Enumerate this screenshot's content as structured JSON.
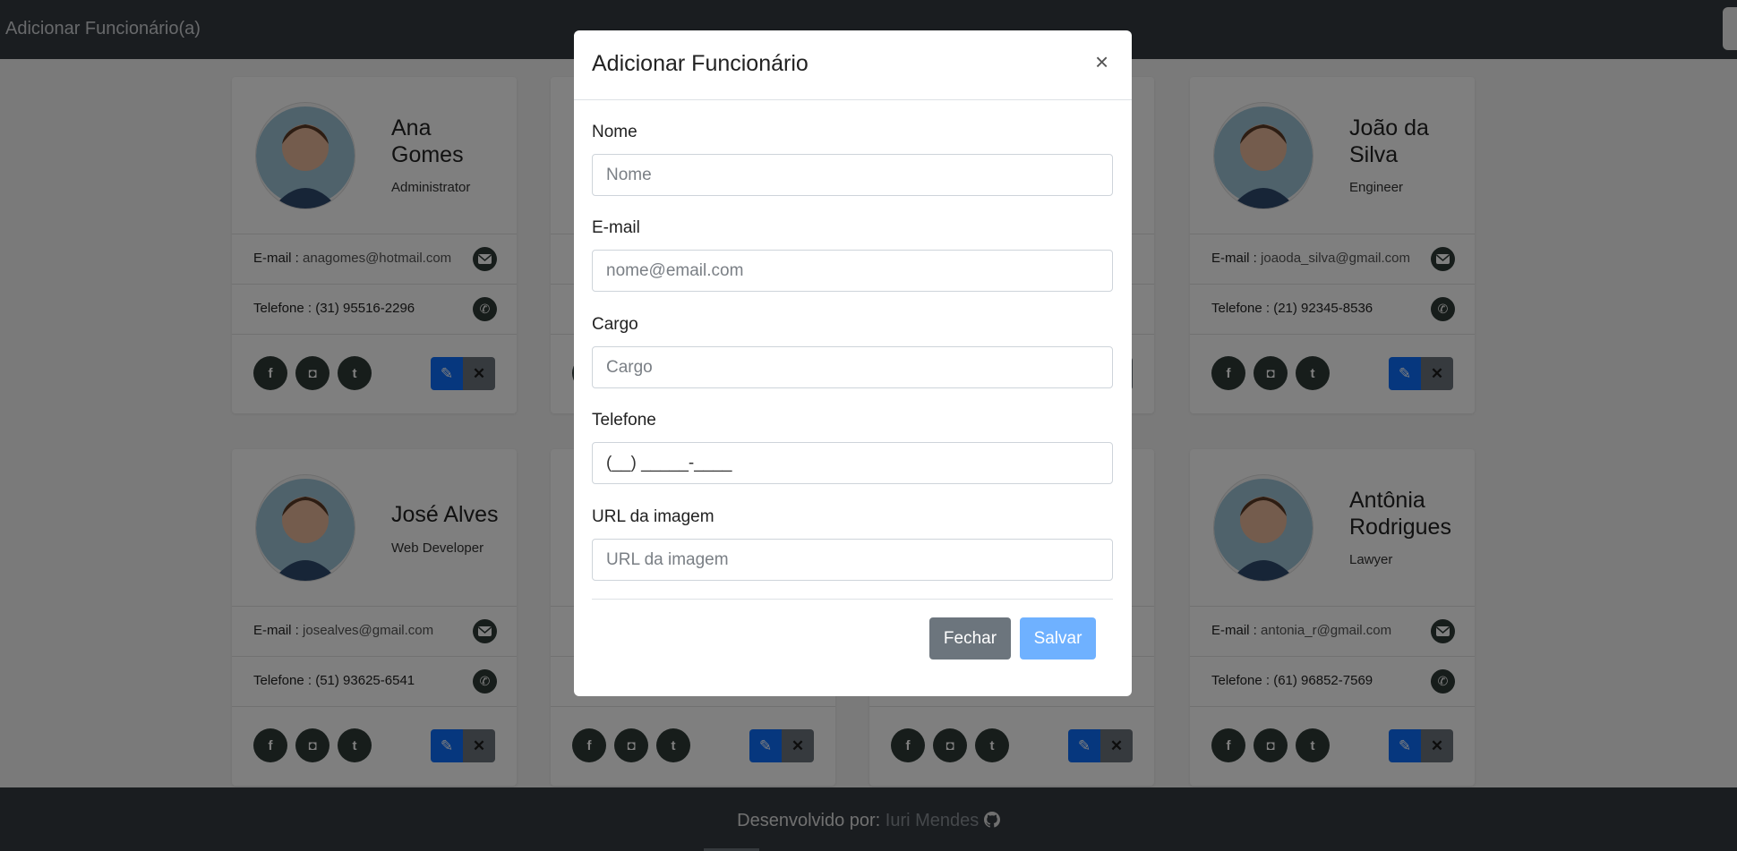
{
  "navbar": {
    "title": "Adicionar Funcionário(a)"
  },
  "cards": [
    {
      "name": "Ana Gomes",
      "role": "Administrator",
      "email_label": "E-mail :",
      "email": "anagomes@hotmail.com",
      "phone_label": "Telefone :",
      "phone": "(31) 95516-2296"
    },
    {
      "name": "João da Silva",
      "role": "Engineer",
      "email_label": "E-mail :",
      "email": "joaoda_silva@gmail.com",
      "phone_label": "Telefone :",
      "phone": "(21) 92345-8536"
    },
    {
      "name": "José Alves",
      "role": "Web Developer",
      "email_label": "E-mail :",
      "email": "josealves@gmail.com",
      "phone_label": "Telefone :",
      "phone": "(51) 93625-6541"
    },
    {
      "name": "Antônia Rodrigues",
      "role": "Lawyer",
      "email_label": "E-mail :",
      "email": "antonia_r@gmail.com",
      "phone_label": "Telefone :",
      "phone": "(61) 96852-7569"
    }
  ],
  "modal": {
    "title": "Adicionar Funcionário",
    "close_icon": "×",
    "fields": {
      "name": {
        "label": "Nome",
        "placeholder": "Nome"
      },
      "email": {
        "label": "E-mail",
        "placeholder": "nome@email.com"
      },
      "role": {
        "label": "Cargo",
        "placeholder": "Cargo"
      },
      "phone": {
        "label": "Telefone",
        "value": "(__) _____-____"
      },
      "image": {
        "label": "URL da imagem",
        "placeholder": "URL da imagem"
      }
    },
    "close_button": "Fechar",
    "save_button": "Salvar"
  },
  "footer": {
    "text": "Desenvolvido por:",
    "author": "Iuri Mendes"
  },
  "icons": {
    "email": "envelope-icon",
    "phone": "phone-icon",
    "facebook": "facebook-icon",
    "instagram": "instagram-icon",
    "twitter": "twitter-icon",
    "edit": "pencil-icon",
    "delete": "x-icon",
    "github": "github-icon"
  },
  "colors": {
    "primary": "#0d6efd",
    "secondary": "#6c757d",
    "dark": "#343a40"
  }
}
